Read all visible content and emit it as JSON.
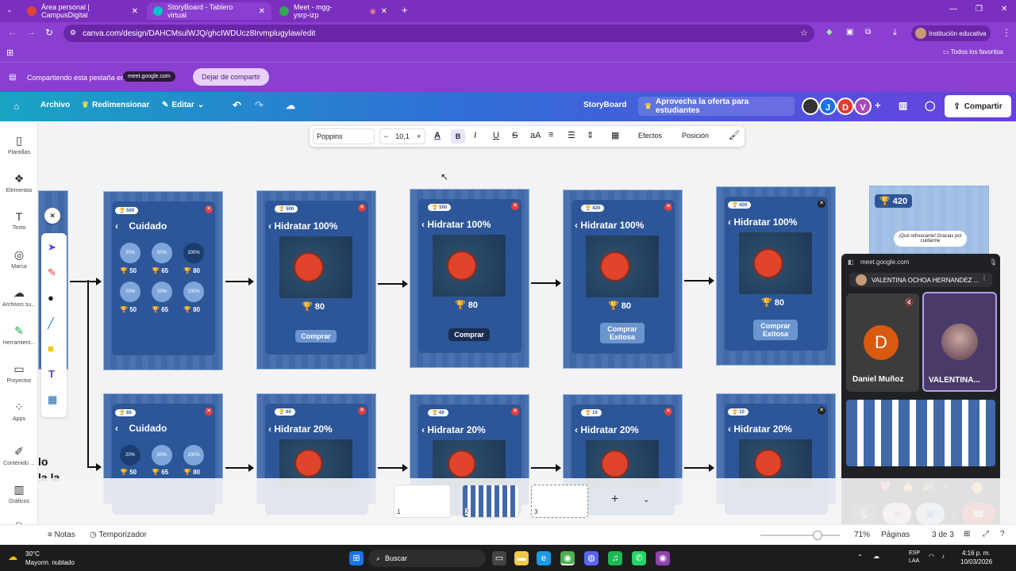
{
  "browser": {
    "tabs": [
      {
        "title": "Área personal | CampusDigital",
        "color": "#e0453a"
      },
      {
        "title": "StoryBoard - Tablero virtual",
        "color": "#00c4cc"
      },
      {
        "title": "Meet - mgg-ysrp-izp",
        "color": "#34a853"
      }
    ],
    "new_tab": "+",
    "url": "canva.com/design/DAHCMsulWJQ/ghcIWDUcz8Irvmplugylaw/edit",
    "profile": "Institución educativa",
    "favorites": "Todos los favoritos"
  },
  "share_bar": {
    "text": "Compartiendo esta pestaña en",
    "site": "meet.google.com",
    "stop_button": "Dejar de compartir"
  },
  "canva_bar": {
    "archivo": "Archivo",
    "redimensionar": "Redimensionar",
    "editar": "Editar",
    "doc_title": "StoryBoard",
    "offer": "Aprovecha la oferta para estudiantes",
    "share": "Compartir",
    "avatars": [
      "J",
      "D",
      "V"
    ],
    "avatar_colors": [
      "#1a73e8",
      "#e53935",
      "#ab47bc"
    ]
  },
  "sidebar": {
    "items": [
      "Plantillas",
      "Elementos",
      "Texto",
      "Marca",
      "Archivos su...",
      "Herramient...",
      "Proyectos",
      "Apps",
      "Contenido ...",
      "Gráficos"
    ]
  },
  "text_toolbar": {
    "font": "Poppins",
    "size": "10,1",
    "effects": "Efectos",
    "position": "Posición"
  },
  "cards_row1": [
    {
      "points": "500",
      "title": "Cuidado",
      "type": "grid"
    },
    {
      "points": "500",
      "title": "Hidratar 100%",
      "price": "80",
      "button": "Comprar"
    },
    {
      "points": "500",
      "title": "Hidratar 100%",
      "price": "80",
      "button": "Comprar"
    },
    {
      "points": "420",
      "title": "Hidratar 100%",
      "price": "80",
      "button": "Comprar Exitosa"
    },
    {
      "points": "420",
      "title": "Hidratar 100%",
      "price": "80",
      "button": "Comprar Exitosa"
    }
  ],
  "grid_prices": [
    "50",
    "65",
    "80",
    "50",
    "65",
    "80"
  ],
  "grid_labels": [
    "20%",
    "50%",
    "100%",
    "20%",
    "50%",
    "100%"
  ],
  "cards_row2": [
    {
      "points": "60",
      "title": "Cuidado"
    },
    {
      "points": "60",
      "title": "Hidratar 20%"
    },
    {
      "points": "60",
      "title": "Hidratar 20%"
    },
    {
      "points": "10",
      "title": "Hidratar 20%"
    },
    {
      "points": "10",
      "title": "Hidratar 20%"
    }
  ],
  "row2_prices": [
    "50",
    "65",
    "80"
  ],
  "last_card": {
    "points": "420",
    "speech": "¡Qué refrescante! Gracias por cuidarme"
  },
  "partial_text": [
    "lo",
    "la la"
  ],
  "meet": {
    "site": "meet.google.com",
    "presenter": "VALENTINA OCHOA HERNANDEZ ...",
    "tile1_name": "Daniel Muñoz",
    "tile1_initial": "D",
    "tile2_name": "VALENTINA..."
  },
  "pages": {
    "numbers": [
      "1",
      "2",
      "3"
    ],
    "notes": "Notas",
    "timer": "Temporizador",
    "zoom": "71%",
    "pages_label": "Páginas",
    "page_count": "3 de 3"
  },
  "taskbar": {
    "weather_temp": "30°C",
    "weather_desc": "Mayorm. nublado",
    "search": "Buscar",
    "lang1": "ESP",
    "lang2": "LAA",
    "time": "4:16 p. m.",
    "date": "10/03/2026"
  }
}
